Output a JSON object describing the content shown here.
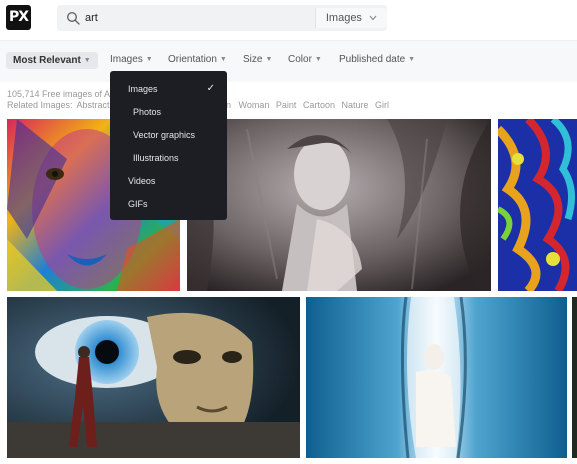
{
  "logo": {
    "text": "PX"
  },
  "search": {
    "query": "art",
    "type_label": "Images"
  },
  "filters": {
    "relevant_label": "Most Relevant",
    "items": [
      "Images",
      "Orientation",
      "Size",
      "Color",
      "Published date"
    ]
  },
  "info": {
    "count_text": "105,714 Free images of Ar",
    "related_label": "Related Images:",
    "related_first": "Abstract",
    "related_rest": [
      "n",
      "Woman",
      "Paint",
      "Cartoon",
      "Nature",
      "Girl"
    ]
  },
  "dropdown": {
    "items": [
      "Images",
      "Photos",
      "Vector graphics",
      "Illustrations",
      "Videos",
      "GIFs"
    ],
    "check": "✓"
  },
  "colors": {
    "dropdown_bg": "#1c1e24",
    "filter_bg": "#f7f8f9"
  }
}
